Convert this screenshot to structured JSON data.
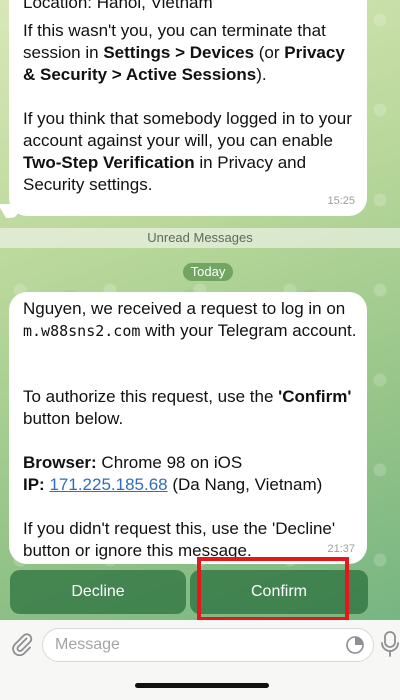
{
  "bubble1": {
    "location": "Location: Hanoi, Vietnam",
    "p2_a": "If this wasn't you, you can terminate that session in ",
    "p2_b1": "Settings > Devices",
    "p2_c": " (or ",
    "p2_b2": "Privacy & Security > Active Sessions",
    "p2_d": ").",
    "p3_a": "If you think that somebody logged in to your account against your will, you can enable ",
    "p3_b": "Two-Step Verification",
    "p3_c": " in Privacy and Security settings.",
    "time": "15:25"
  },
  "unread_label": "Unread Messages",
  "date_label": "Today",
  "bubble2": {
    "p1_a": "Nguyen, we received a request to log in on ",
    "p1_domain": "m.w88sns2.com",
    "p1_b": " with your Telegram account.",
    "p2_a": "To authorize this request, use the ",
    "p2_b": "'Confirm'",
    "p2_c": " button below.",
    "browser_label": "Browser:",
    "browser_value": " Chrome 98 on iOS",
    "ip_label": "IP:",
    "ip_value": "171.225.185.68",
    "ip_location": " (Da Nang, Vietnam)",
    "p4": "If you didn't request this, use the 'Decline' button or ignore this message.",
    "time": "21:37"
  },
  "buttons": {
    "decline": "Decline",
    "confirm": "Confirm"
  },
  "input": {
    "placeholder": "Message"
  },
  "colors": {
    "highlight": "#e8151b",
    "link": "#2f6dbd",
    "button_bg": "#2e7a45"
  },
  "icons": [
    "paperclip-icon",
    "sticker-icon",
    "microphone-icon"
  ]
}
